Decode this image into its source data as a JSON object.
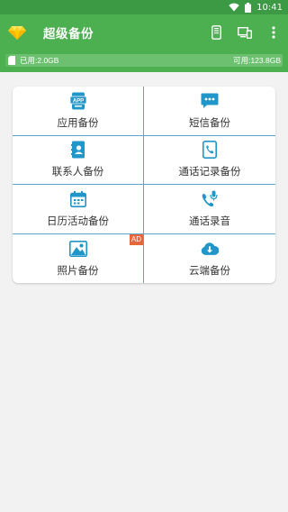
{
  "status_bar": {
    "time": "10:41"
  },
  "app": {
    "title": "超级备份"
  },
  "storage": {
    "used_label": "已用:2.0GB",
    "free_label": "可用:123.8GB",
    "used_fraction": 0.016
  },
  "grid": {
    "items": [
      {
        "label": "应用备份",
        "icon": "app-icon"
      },
      {
        "label": "短信备份",
        "icon": "sms-icon"
      },
      {
        "label": "联系人备份",
        "icon": "contacts-icon"
      },
      {
        "label": "通话记录备份",
        "icon": "call-log-icon"
      },
      {
        "label": "日历活动备份",
        "icon": "calendar-icon"
      },
      {
        "label": "通话录音",
        "icon": "call-record-icon"
      },
      {
        "label": "照片备份",
        "icon": "photo-icon",
        "badge": "AD"
      },
      {
        "label": "云端备份",
        "icon": "cloud-icon"
      }
    ]
  },
  "colors": {
    "primary": "#4caf50",
    "accent": "#2196c8",
    "divider": "#5aa7c9",
    "ad_badge": "#e8663a"
  }
}
